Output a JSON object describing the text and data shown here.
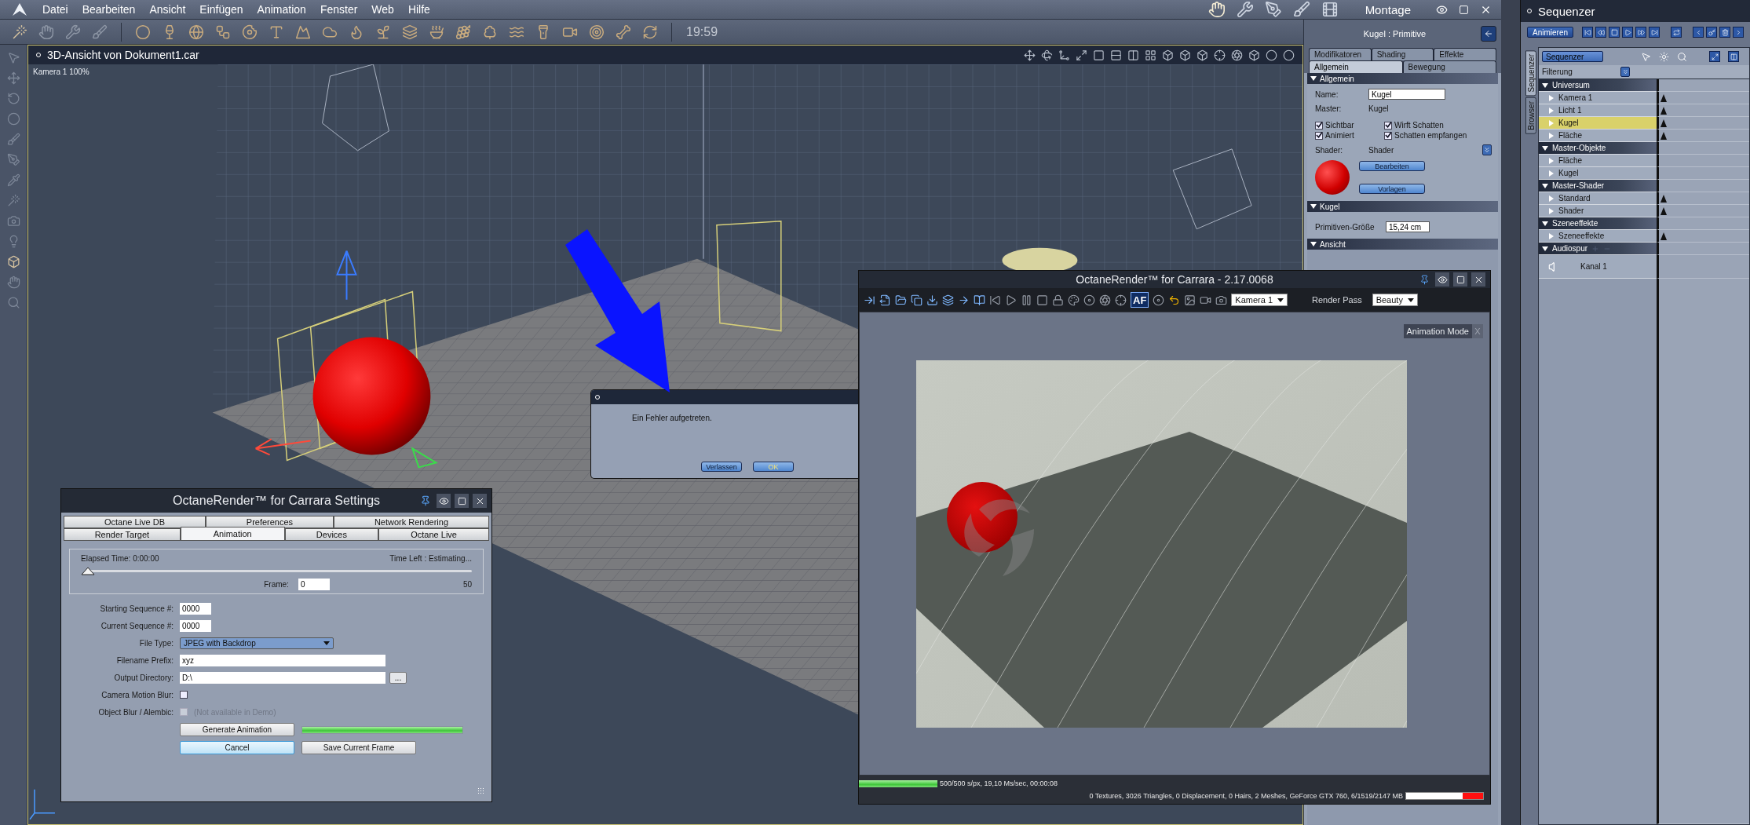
{
  "menu_bar": {
    "items": [
      "Datei",
      "Bearbeiten",
      "Ansicht",
      "Einfügen",
      "Animation",
      "Fenster",
      "Web",
      "Hilfe"
    ],
    "room": "Montage"
  },
  "toolbar": {
    "clock": "19:59"
  },
  "viewport": {
    "title": "3D-Ansicht von Dokument1.car",
    "camera_label": "Kamera 1 100%"
  },
  "properties": {
    "object_title": "Kugel : Primitive",
    "tabs_row1": [
      {
        "label": "Modifikatoren",
        "selected": false
      },
      {
        "label": "Shading",
        "selected": false
      },
      {
        "label": "Effekte",
        "selected": false
      }
    ],
    "tabs_row2": [
      {
        "label": "Allgemein",
        "selected": true
      },
      {
        "label": "Bewegung",
        "selected": false
      }
    ],
    "general": {
      "header": "Allgemein",
      "expanded": true,
      "name_label": "Name:",
      "name_value": "Kugel",
      "master_label": "Master:",
      "master_value": "Kugel",
      "options": [
        {
          "label": "Sichtbar",
          "checked": true
        },
        {
          "label": "Wirft Schatten",
          "checked": true
        },
        {
          "label": "Animiert",
          "checked": true
        },
        {
          "label": "Schatten empfangen",
          "checked": true
        }
      ],
      "shader_label": "Shader:",
      "shader_value": "Shader",
      "buttons": [
        "Bearbeiten",
        "Vorlagen"
      ]
    },
    "primitive": {
      "header": "Kugel",
      "expanded": true,
      "size_label": "Primitiven-Größe",
      "size_value": "15,24 cm"
    },
    "view": {
      "header": "Ansicht",
      "expanded": true
    }
  },
  "sequencer": {
    "title": "Sequenzer",
    "animate_button": "Animieren",
    "mode": "Sequenzer",
    "filter_label": "Filterung",
    "side_tabs": [
      {
        "label": "Sequenzer",
        "selected": true
      },
      {
        "label": "Browser",
        "selected": false
      }
    ],
    "tracks": [
      {
        "label": "Universum",
        "expanded": true,
        "children": [
          {
            "label": "Kamera 1",
            "kind": "track",
            "selected": false,
            "keyframe": true
          },
          {
            "label": "Licht 1",
            "kind": "track",
            "selected": false,
            "keyframe": true
          },
          {
            "label": "Kugel",
            "kind": "track",
            "selected": true,
            "keyframe": true
          },
          {
            "label": "Fläche",
            "kind": "track",
            "selected": false,
            "keyframe": true
          }
        ]
      },
      {
        "label": "Master-Objekte",
        "expanded": true,
        "children": [
          {
            "label": "Fläche",
            "kind": "track",
            "selected": false,
            "keyframe": false
          },
          {
            "label": "Kugel",
            "kind": "track",
            "selected": false,
            "keyframe": false
          }
        ]
      },
      {
        "label": "Master-Shader",
        "expanded": true,
        "children": [
          {
            "label": "Standard",
            "kind": "track",
            "selected": false,
            "keyframe": true
          },
          {
            "label": "Shader",
            "kind": "track",
            "selected": false,
            "keyframe": true
          }
        ]
      },
      {
        "label": "Szeneeffekte",
        "expanded": true,
        "children": [
          {
            "label": "Szeneeffekte",
            "kind": "track",
            "selected": false,
            "keyframe": true
          }
        ]
      },
      {
        "label": "Audiospur",
        "expanded": true,
        "children": [
          {
            "label": "Kanal 1",
            "kind": "audio",
            "selected": false
          }
        ]
      }
    ]
  },
  "settings_dialog": {
    "title": "OctaneRender™ for Carrara Settings",
    "tabs_row1": [
      {
        "label": "Octane Live DB",
        "selected": false
      },
      {
        "label": "Preferences",
        "selected": false
      },
      {
        "label": "Network Rendering",
        "selected": false
      }
    ],
    "tabs_row2": [
      {
        "label": "Render Target",
        "selected": false
      },
      {
        "label": "Animation",
        "selected": true
      },
      {
        "label": "Devices",
        "selected": false
      },
      {
        "label": "Octane Live",
        "selected": false
      }
    ],
    "elapsed": "Elapsed Time: 0:00:00",
    "time_left": "Time Left : Estimating...",
    "frame_slider": {
      "level": 0
    },
    "frame_label": "Frame:",
    "frame_value": "0",
    "frame_max": "50",
    "fields": [
      {
        "kind": "short",
        "label": "Starting Sequence #:",
        "value": "0000"
      },
      {
        "kind": "short",
        "label": "Current Sequence #:",
        "value": "0000"
      },
      {
        "kind": "dropdown",
        "label": "File Type:",
        "value": "JPEG with Backdrop"
      },
      {
        "kind": "text",
        "label": "Filename Prefix:",
        "value": "xyz"
      },
      {
        "kind": "path",
        "label": "Output Directory:",
        "value": "D:\\",
        "browse": "..."
      }
    ],
    "options": [
      {
        "label": "Camera Motion Blur:",
        "checked": false,
        "disabled": false
      },
      {
        "label": "Object Blur / Alembic:",
        "checked": false,
        "disabled": true,
        "note": "(Not available in Demo)"
      }
    ],
    "generate_button": "Generate Animation",
    "progress": {
      "level": 1
    },
    "cancel_button": "Cancel",
    "save_button": "Save Current Frame"
  },
  "error_dialog": {
    "message": "Ein Fehler aufgetreten.",
    "buttons": [
      {
        "label": "Verlassen",
        "default": false
      },
      {
        "label": "OK",
        "default": true
      }
    ]
  },
  "render_window": {
    "title": "OctaneRender™ for Carrara - 2.17.0068",
    "af_button": {
      "label": "AF",
      "on": true
    },
    "camera": "Kamera 1",
    "render_pass_label": "Render Pass",
    "render_pass": "Beauty",
    "mode_badge": "Animation Mode",
    "mode_close": "X",
    "progress": {
      "level": 1
    },
    "stats": "500/500 s/px, 19,10 Ms/sec, 00:00:08",
    "info": "0 Textures, 3026 Triangles, 0 Displacement, 0 Hairs, 2 Meshes, GeForce GTX 760, 6/1519/2147 MB",
    "memory": {
      "level": 0.27
    }
  }
}
